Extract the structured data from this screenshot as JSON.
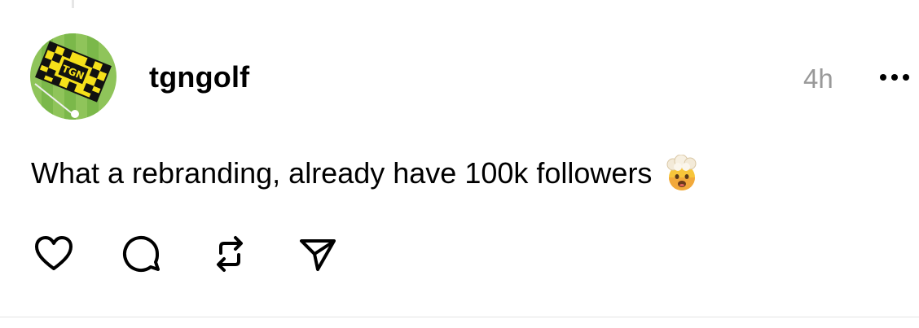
{
  "post": {
    "username": "tgngolf",
    "timestamp": "4h",
    "text": "What a rebranding, already have 100k followers",
    "emoji": "exploding-head",
    "avatar": {
      "logo_text": "TGN",
      "colors": {
        "grass_light": "#8fc45a",
        "grass_dark": "#6fae3d",
        "flag_yellow": "#f5e01a",
        "flag_black": "#111111"
      }
    }
  },
  "actions": {
    "like_icon": "heart-icon",
    "comment_icon": "comment-icon",
    "repost_icon": "repost-icon",
    "share_icon": "send-icon"
  }
}
